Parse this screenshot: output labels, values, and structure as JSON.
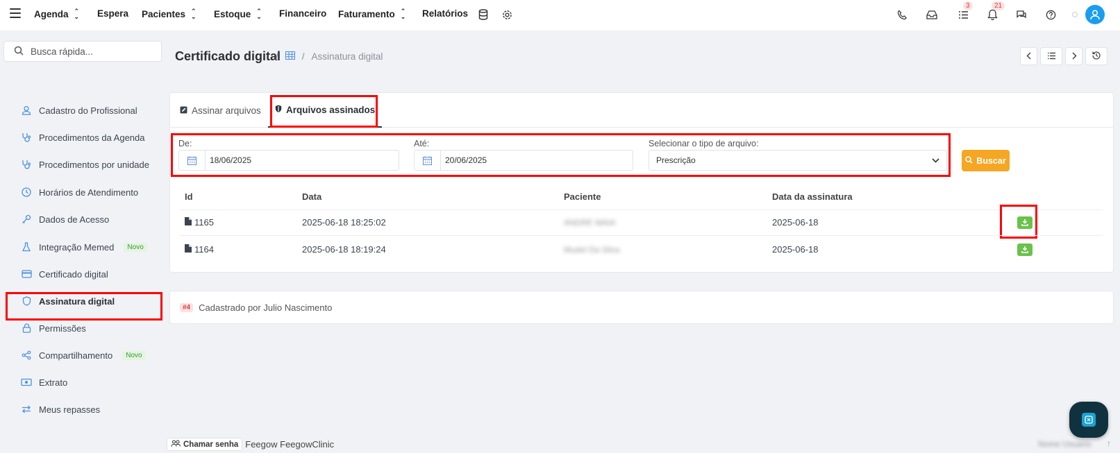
{
  "topnav": {
    "items": [
      {
        "label": "Agenda",
        "has_chevron": true
      },
      {
        "label": "Espera",
        "has_chevron": false
      },
      {
        "label": "Pacientes",
        "has_chevron": true
      },
      {
        "label": "Estoque",
        "has_chevron": true
      },
      {
        "label": "Financeiro",
        "has_chevron": false
      },
      {
        "label": "Faturamento",
        "has_chevron": true
      },
      {
        "label": "Relatórios",
        "has_chevron": false
      }
    ],
    "tasks_badge": "3",
    "notifications_badge": "21"
  },
  "search": {
    "placeholder": "Busca rápida..."
  },
  "sidebar": {
    "items": [
      {
        "label": "Cadastro do Profissional",
        "icon": "user-icon"
      },
      {
        "label": "Procedimentos da Agenda",
        "icon": "stethoscope-icon"
      },
      {
        "label": "Procedimentos por unidade",
        "icon": "stethoscope-icon"
      },
      {
        "label": "Horários de Atendimento",
        "icon": "clock-icon"
      },
      {
        "label": "Dados de Acesso",
        "icon": "key-icon"
      },
      {
        "label": "Integração Memed",
        "icon": "flask-icon",
        "tag": "Novo"
      },
      {
        "label": "Certificado digital",
        "icon": "card-icon"
      },
      {
        "label": "Assinatura digital",
        "icon": "shield-icon",
        "active": true
      },
      {
        "label": "Permissões",
        "icon": "lock-icon"
      },
      {
        "label": "Compartilhamento",
        "icon": "share-icon",
        "tag": "Novo"
      },
      {
        "label": "Extrato",
        "icon": "money-icon"
      },
      {
        "label": "Meus repasses",
        "icon": "transfer-icon"
      }
    ]
  },
  "header": {
    "title": "Certificado digital",
    "breadcrumb_separator": "/",
    "breadcrumb_current": "Assinatura digital"
  },
  "tabs": [
    {
      "label": "Assinar arquivos",
      "active": false
    },
    {
      "label": "Arquivos assinados",
      "active": true
    }
  ],
  "filters": {
    "from_label": "De:",
    "from_value": "18/06/2025",
    "to_label": "Até:",
    "to_value": "20/06/2025",
    "type_label": "Selecionar o tipo de arquivo:",
    "type_value": "Prescrição",
    "search_button": "Buscar"
  },
  "table": {
    "columns": [
      "Id",
      "Data",
      "Paciente",
      "Data da assinatura"
    ],
    "rows": [
      {
        "id": "1165",
        "data": "2025-06-18 18:25:02",
        "paciente": "ANDRE MAIA",
        "data_assinatura": "2025-06-18"
      },
      {
        "id": "1164",
        "data": "2025-06-18 18:19:24",
        "paciente": "Mudel Da Silva",
        "data_assinatura": "2025-06-18"
      }
    ]
  },
  "footer_card": {
    "badge": "#4",
    "text": "Cadastrado por Julio Nascimento"
  },
  "bottom": {
    "call_button": "Chamar senha",
    "brand": "Feegow FeegowClinic",
    "user_blurred": "Nome Usuario"
  },
  "colors": {
    "accent_blue": "#1a9df0",
    "buscar_orange": "#f5a623",
    "download_green": "#6ac24a",
    "highlight_red": "#ff0000"
  }
}
